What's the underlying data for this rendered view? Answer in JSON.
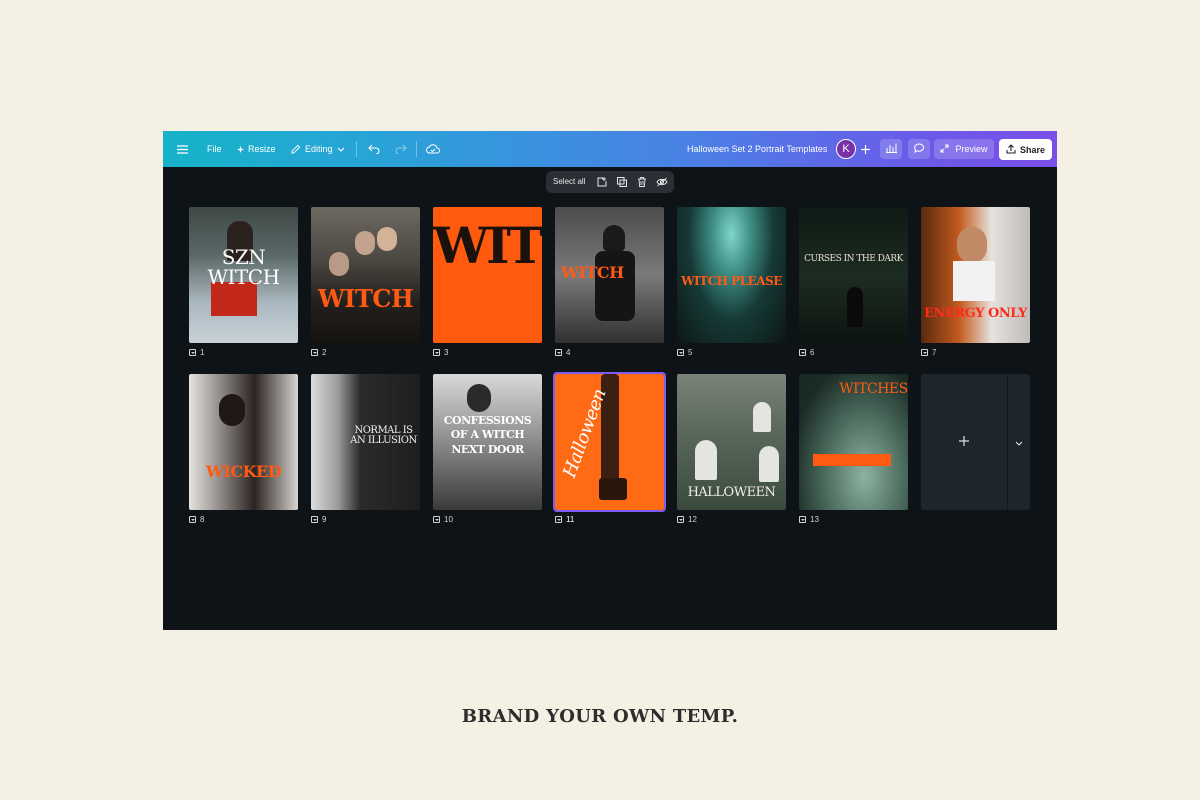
{
  "topbar": {
    "file_label": "File",
    "resize_label": "Resize",
    "editing_label": "Editing",
    "doc_title": "Halloween Set 2  Portrait Templates",
    "avatar_initial": "K",
    "preview_label": "Preview",
    "share_label": "Share",
    "icons": [
      "menu-icon",
      "sparkle-icon",
      "pencil-icon",
      "chevron-down-icon",
      "undo-icon",
      "redo-icon",
      "cloud-save-icon",
      "plus-icon",
      "chart-icon",
      "comment-icon",
      "expand-icon",
      "upload-icon"
    ]
  },
  "selection_bar": {
    "select_all_label": "Select all",
    "icons": [
      "add-page-icon",
      "duplicate-icon",
      "trash-icon",
      "hide-icon"
    ]
  },
  "pages": [
    {
      "number": "1",
      "title": "SZN WITCH",
      "accent": "#d8401d"
    },
    {
      "number": "2",
      "title": "WITCH",
      "accent": "#ff5a14"
    },
    {
      "number": "3",
      "title": "WITCH",
      "accent": "#ff5a14"
    },
    {
      "number": "4",
      "title": "WITCH",
      "accent": "#ff5a14"
    },
    {
      "number": "5",
      "title": "WITCH PLEASE",
      "accent": "#ff5a14"
    },
    {
      "number": "6",
      "title": "CURSES IN THE DARK",
      "accent": "#ff5a14"
    },
    {
      "number": "7",
      "title": "ENERGY ONLY",
      "accent": "#ff2a1a"
    },
    {
      "number": "8",
      "title": "WICKED",
      "accent": "#ff5a14"
    },
    {
      "number": "9",
      "title": "NORMAL IS AN ILLUSION",
      "accent": "#ffffff"
    },
    {
      "number": "10",
      "title": "CONFESSIONS OF A WITCH NEXT DOOR",
      "accent": "#ffffff"
    },
    {
      "number": "11",
      "title": "Halloween",
      "accent": "#ff6a14"
    },
    {
      "number": "12",
      "title": "HALLOWEEN",
      "accent": "#ff5a14"
    },
    {
      "number": "13",
      "title": "WITCHES",
      "accent": "#ff5a14"
    }
  ],
  "selected_page": "11",
  "caption": "BRAND YOUR OWN TEMP."
}
